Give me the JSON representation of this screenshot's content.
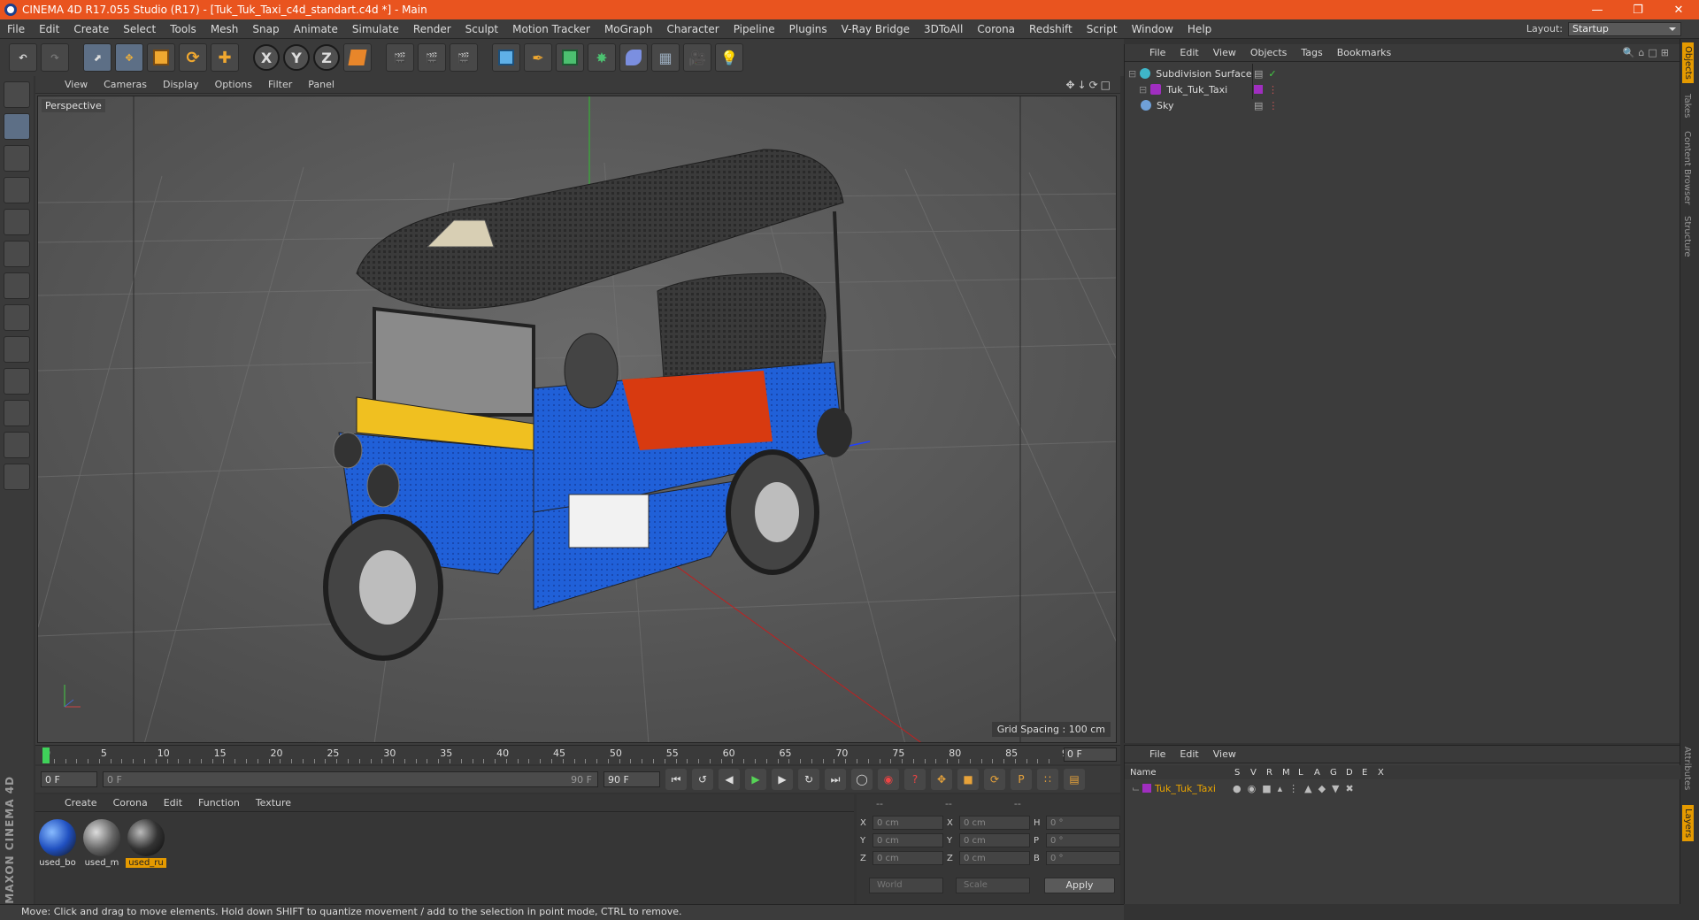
{
  "window": {
    "title": "CINEMA 4D R17.055 Studio (R17) - [Tuk_Tuk_Taxi_c4d_standart.c4d *] - Main"
  },
  "menu": [
    "File",
    "Edit",
    "Create",
    "Select",
    "Tools",
    "Mesh",
    "Snap",
    "Animate",
    "Simulate",
    "Render",
    "Sculpt",
    "Motion Tracker",
    "MoGraph",
    "Character",
    "Pipeline",
    "Plugins",
    "V-Ray Bridge",
    "3DToAll",
    "Corona",
    "Redshift",
    "Script",
    "Window",
    "Help"
  ],
  "layout": {
    "label": "Layout:",
    "value": "Startup"
  },
  "toolbar": {
    "axes": [
      "X",
      "Y",
      "Z"
    ]
  },
  "viewport": {
    "menu": [
      "View",
      "Cameras",
      "Display",
      "Options",
      "Filter",
      "Panel"
    ],
    "camera_label": "Perspective",
    "grid_spacing": "Grid Spacing : 100 cm"
  },
  "timeline": {
    "ticks": [
      "0",
      "5",
      "10",
      "15",
      "20",
      "25",
      "30",
      "35",
      "40",
      "45",
      "50",
      "55",
      "60",
      "65",
      "70",
      "75",
      "80",
      "85",
      "90"
    ],
    "current_frame": "0 F",
    "start": "0 F",
    "range_start": "0 F",
    "range_end": "90 F",
    "end": "90 F"
  },
  "materials": {
    "menu": [
      "Create",
      "Corona",
      "Edit",
      "Function",
      "Texture"
    ],
    "items": [
      {
        "label": "used_bo",
        "active": false
      },
      {
        "label": "used_m",
        "active": false
      },
      {
        "label": "used_ru",
        "active": true
      }
    ]
  },
  "coords": {
    "headers": [
      "--",
      "--",
      "--"
    ],
    "rows": [
      {
        "a": "X",
        "av": "0 cm",
        "b": "X",
        "bv": "0 cm",
        "c": "H",
        "cv": "0 °"
      },
      {
        "a": "Y",
        "av": "0 cm",
        "b": "Y",
        "bv": "0 cm",
        "c": "P",
        "cv": "0 °"
      },
      {
        "a": "Z",
        "av": "0 cm",
        "b": "Z",
        "bv": "0 cm",
        "c": "B",
        "cv": "0 °"
      }
    ],
    "mode1": "World",
    "mode2": "Scale",
    "apply": "Apply"
  },
  "status": "Move: Click and drag to move elements. Hold down SHIFT to quantize movement / add to the selection in point mode, CTRL to remove.",
  "objects": {
    "menu": [
      "File",
      "Edit",
      "View",
      "Objects",
      "Tags",
      "Bookmarks"
    ],
    "items": [
      {
        "name": "Subdivision Surface",
        "color": "#3fb6c9"
      },
      {
        "name": "Tuk_Tuk_Taxi",
        "color": "#a02ec0"
      },
      {
        "name": "Sky",
        "color": "#6fa0d8"
      }
    ]
  },
  "side_tabs": [
    "Objects",
    "Takes",
    "Content Browser",
    "Structure"
  ],
  "side_tabs_bottom": [
    "Attributes",
    "Layers"
  ],
  "layers": {
    "menu": [
      "File",
      "Edit",
      "View"
    ],
    "columns": [
      "Name",
      "S",
      "V",
      "R",
      "M",
      "L",
      "A",
      "G",
      "D",
      "E",
      "X"
    ],
    "row_name": "Tuk_Tuk_Taxi"
  },
  "brand": "MAXON CINEMA 4D"
}
